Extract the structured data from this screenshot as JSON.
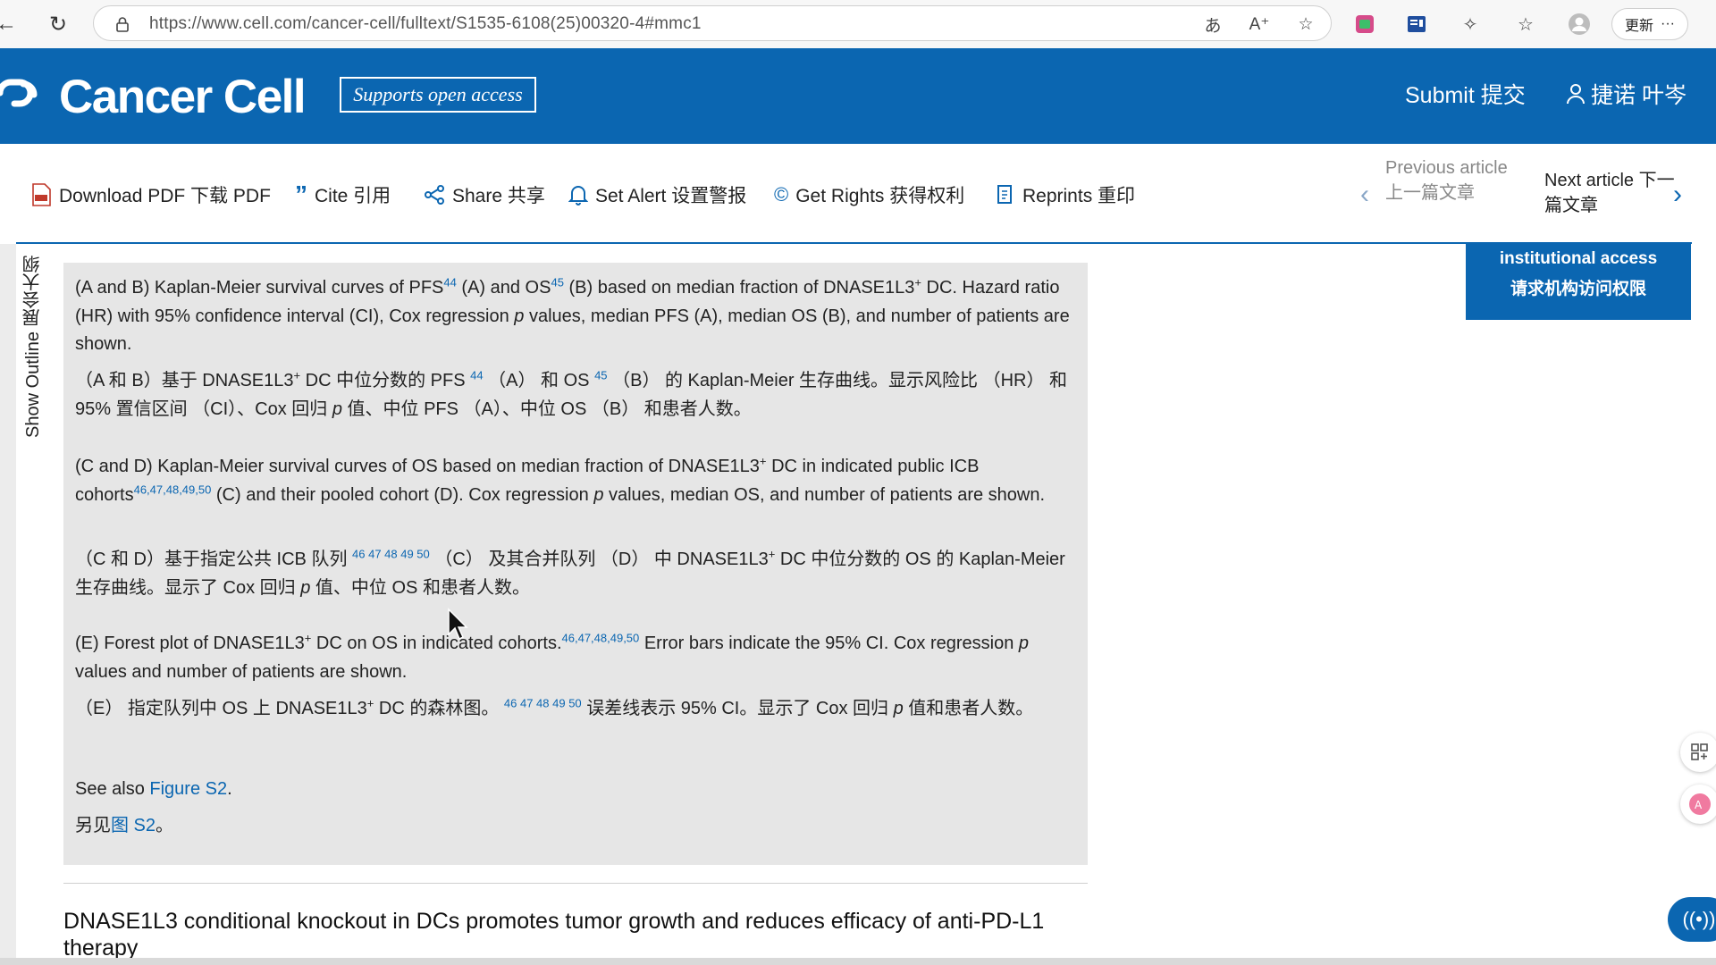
{
  "browser": {
    "url": "https://www.cell.com/cancer-cell/fulltext/S1535-6108(25)00320-4#mmc1",
    "update_label": "更新",
    "more_label": "···",
    "icons": [
      "back-icon",
      "refresh-icon",
      "lock-icon",
      "translate-icon",
      "read-aloud-icon",
      "favorite-icon",
      "extension-icon",
      "collections-icon",
      "profile-icon"
    ]
  },
  "header": {
    "journal_title": "Cancer Cell",
    "open_access": "Supports open access",
    "submit": "Submit  提交",
    "user": "捷诺 叶岑",
    "brand_color": "#0b66b1"
  },
  "toolbar": {
    "download": "Download PDF  下载 PDF",
    "cite": "Cite  引用",
    "share": "Share  共享",
    "alert": "Set Alert  设置警报",
    "rights": "Get Rights  获得权利",
    "reprints": "Reprints  重印",
    "prev_article": "Previous article  上一篇文章",
    "next_article": "Next article  下一篇文章"
  },
  "outline": {
    "label": "Show Outline  展会大纲"
  },
  "access": {
    "line1": "institutional access",
    "line2": "请求机构访问权限"
  },
  "caption": {
    "ab_en_1": "(A and B) Kaplan-Meier survival curves of PFS",
    "ab_en_ref1": "44",
    "ab_en_2": " (A) and OS",
    "ab_en_ref2": "45",
    "ab_en_3": " (B) based on median fraction of DNASE1L3",
    "ab_en_4": " DC. Hazard ratio (HR) with 95% confidence interval (CI), Cox regression ",
    "ab_en_p": "p",
    "ab_en_5": " values, median PFS (A), median OS (B), and number of patients are shown.",
    "ab_zh_1": "（A 和 B）基于 DNASE1L3",
    "ab_zh_2": " DC 中位分数的 PFS ",
    "ab_zh_ref1": "44",
    "ab_zh_3": " （A） 和 OS ",
    "ab_zh_ref2": "45",
    "ab_zh_4": " （B） 的 Kaplan-Meier 生存曲线。显示风险比 （HR） 和 95% 置信区间 （CI）、Cox 回归 ",
    "ab_zh_5": " 值、中位 PFS （A）、中位 OS （B） 和患者人数。",
    "cd_en_1": "(C and D) Kaplan-Meier survival curves of OS based on median fraction of DNASE1L3",
    "cd_en_2": " DC in indicated public ICB cohorts",
    "cd_en_refs": "46,47,48,49,50",
    "cd_en_3": " (C) and their pooled cohort (D). Cox regression ",
    "cd_en_4": " values, median OS, and number of patients are shown.",
    "cd_zh_1": "（C 和 D）基于指定公共 ICB 队列 ",
    "cd_zh_refs": "46 47 48 49 50",
    "cd_zh_2": " （C） 及其合并队列 （D） 中 DNASE1L3",
    "cd_zh_3": " DC 中位分数的 OS 的 Kaplan-Meier 生存曲线。显示了 Cox 回归 ",
    "cd_zh_4": " 值、中位 OS 和患者人数。",
    "e_en_1": "(E) Forest plot of DNASE1L3",
    "e_en_2": " DC on OS in indicated cohorts.",
    "e_en_refs": "46,47,48,49,50",
    "e_en_3": " Error bars indicate the 95% CI. Cox regression ",
    "e_en_4": " values and number of patients are shown.",
    "e_zh_1": "（E） 指定队列中 OS 上 DNASE1L3",
    "e_zh_2": " DC 的森林图。 ",
    "e_zh_refs": "46 47 48 49 50",
    "e_zh_3": " 误差线表示 95% CI。显示了 Cox 回归 ",
    "e_zh_4": " 值和患者人数。",
    "plus": "+",
    "see_also_en": "See also ",
    "see_also_en_link": "Figure S2",
    "see_also_en_end": ".",
    "see_also_zh": "另见",
    "see_also_zh_link": "图 S2",
    "see_also_zh_end": "。"
  },
  "section_heading": "DNASE1L3 conditional knockout in DCs promotes tumor growth and reduces efficacy of anti-PD-L1 therapy"
}
